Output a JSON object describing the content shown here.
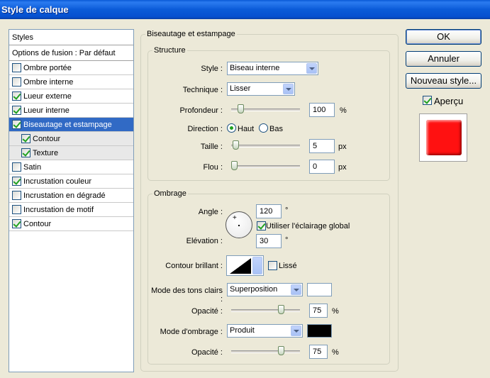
{
  "window": {
    "title": "Style de calque"
  },
  "styles_panel": {
    "header": "Styles",
    "blending_options": "Options de fusion : Par défaut",
    "items": [
      {
        "label": "Ombre portée",
        "checked": false
      },
      {
        "label": "Ombre interne",
        "checked": false
      },
      {
        "label": "Lueur externe",
        "checked": true
      },
      {
        "label": "Lueur interne",
        "checked": true
      },
      {
        "label": "Biseautage et estampage",
        "checked": true,
        "selected": true
      },
      {
        "label": "Contour",
        "checked": true,
        "sub": true
      },
      {
        "label": "Texture",
        "checked": true,
        "sub": true
      },
      {
        "label": "Satin",
        "checked": false
      },
      {
        "label": "Incrustation couleur",
        "checked": true
      },
      {
        "label": "Incrustation en dégradé",
        "checked": false
      },
      {
        "label": "Incrustation de motif",
        "checked": false
      },
      {
        "label": "Contour",
        "checked": true
      }
    ]
  },
  "bevel": {
    "section_title": "Biseautage et estampage",
    "structure": {
      "title": "Structure",
      "style_label": "Style :",
      "style_value": "Biseau interne",
      "technique_label": "Technique :",
      "technique_value": "Lisser",
      "depth_label": "Profondeur :",
      "depth_value": "100",
      "depth_unit": "%",
      "depth_slider_fraction": 0.1,
      "direction_label": "Direction :",
      "direction_up": "Haut",
      "direction_down": "Bas",
      "direction_selected": "Haut",
      "size_label": "Taille :",
      "size_value": "5",
      "size_unit": "px",
      "size_slider_fraction": 0.02,
      "soften_label": "Flou :",
      "soften_value": "0",
      "soften_unit": "px",
      "soften_slider_fraction": 0.0
    },
    "shading": {
      "title": "Ombrage",
      "angle_label": "Angle :",
      "angle_value": "120",
      "angle_unit": "°",
      "global_light_label": "Utiliser l'éclairage global",
      "global_light_checked": true,
      "altitude_label": "Elévation :",
      "altitude_value": "30",
      "altitude_unit": "°",
      "gloss_contour_label": "Contour brillant :",
      "antialiased_label": "Lissé",
      "antialiased_checked": false,
      "highlight_mode_label": "Mode des tons clairs :",
      "highlight_mode_value": "Superposition",
      "highlight_color": "#ffffff",
      "highlight_opacity_label": "Opacité :",
      "highlight_opacity_value": "75",
      "highlight_opacity_unit": "%",
      "highlight_opacity_fraction": 0.75,
      "shadow_mode_label": "Mode d'ombrage :",
      "shadow_mode_value": "Produit",
      "shadow_color": "#000000",
      "shadow_opacity_label": "Opacité :",
      "shadow_opacity_value": "75",
      "shadow_opacity_unit": "%",
      "shadow_opacity_fraction": 0.75
    }
  },
  "buttons": {
    "ok": "OK",
    "cancel": "Annuler",
    "new_style": "Nouveau style..."
  },
  "preview": {
    "label": "Aperçu",
    "checked": true,
    "color": "#ff1111"
  }
}
